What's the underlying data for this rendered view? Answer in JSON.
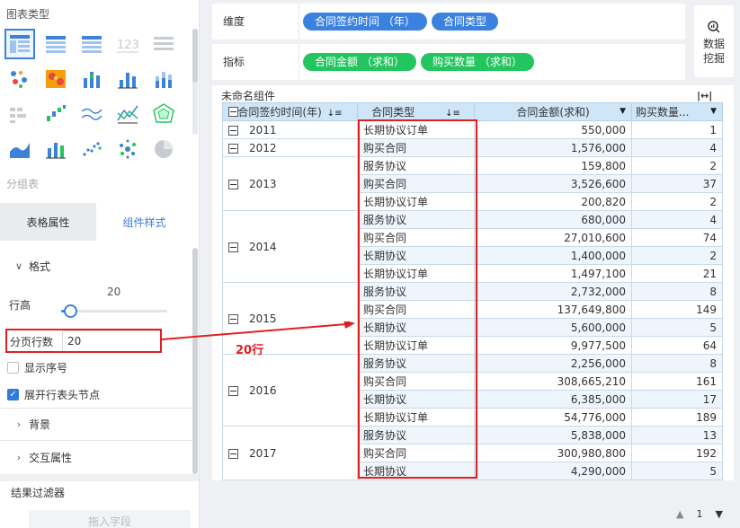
{
  "left": {
    "chart_type_title": "图表类型",
    "chart_icons": [
      "cross-table-icon",
      "grouped-table-icon",
      "detail-table-icon",
      "number-icon",
      "list-table-icon",
      "dot-map-icon",
      "heat-map-icon",
      "grouped-bar-icon",
      "bar-chart-icon",
      "stacked-bar-icon",
      "gantt-icon",
      "waterfall-icon",
      "multi-line-icon",
      "line-point-icon",
      "radar-icon",
      "area-icon",
      "combo-bar-icon",
      "scatter-icon",
      "bubble-icon",
      "pie-icon"
    ],
    "group_table": "分组表",
    "tabs": {
      "table_props": "表格属性",
      "component_style": "组件样式"
    },
    "format": "格式",
    "row_height_label": "行高",
    "row_height_value": "20",
    "row_height_fraction": 0.08,
    "page_rows_label": "分页行数",
    "page_rows_value": "20",
    "show_index_label": "显示序号",
    "expand_header_label": "展开行表头节点",
    "background_label": "背景",
    "interaction_label": "交互属性",
    "result_filter_label": "结果过滤器",
    "drag_field_placeholder": "拖入字段"
  },
  "shelves": {
    "dimension_label": "维度",
    "dimensions": [
      "合同签约时间 （年）",
      "合同类型"
    ],
    "metric_label": "指标",
    "metrics": [
      "合同金额 （求和）",
      "购买数量 （求和）"
    ]
  },
  "mining": {
    "line1": "数据",
    "line2": "挖掘"
  },
  "component_title": "未命名组件",
  "expand_icon_text": "|↔|",
  "table": {
    "headers": [
      "合同签约时间(年)",
      "合同类型",
      "合同金额(求和)",
      "购买数量..."
    ],
    "groups": [
      {
        "year": "2011",
        "rows": [
          [
            "长期协议订单",
            "550,000",
            "1"
          ]
        ]
      },
      {
        "year": "2012",
        "rows": [
          [
            "购买合同",
            "1,576,000",
            "4"
          ]
        ]
      },
      {
        "year": "2013",
        "rows": [
          [
            "服务协议",
            "159,800",
            "2"
          ],
          [
            "购买合同",
            "3,526,600",
            "37"
          ],
          [
            "长期协议订单",
            "200,820",
            "2"
          ]
        ]
      },
      {
        "year": "2014",
        "rows": [
          [
            "服务协议",
            "680,000",
            "4"
          ],
          [
            "购买合同",
            "27,010,600",
            "74"
          ],
          [
            "长期协议",
            "1,400,000",
            "2"
          ],
          [
            "长期协议订单",
            "1,497,100",
            "21"
          ]
        ]
      },
      {
        "year": "2015",
        "rows": [
          [
            "服务协议",
            "2,732,000",
            "8"
          ],
          [
            "购买合同",
            "137,649,800",
            "149"
          ],
          [
            "长期协议",
            "5,600,000",
            "5"
          ],
          [
            "长期协议订单",
            "9,977,500",
            "64"
          ]
        ]
      },
      {
        "year": "2016",
        "rows": [
          [
            "服务协议",
            "2,256,000",
            "8"
          ],
          [
            "购买合同",
            "308,665,210",
            "161"
          ],
          [
            "长期协议",
            "6,385,000",
            "17"
          ],
          [
            "长期协议订单",
            "54,776,000",
            "189"
          ]
        ]
      },
      {
        "year": "2017",
        "rows": [
          [
            "服务协议",
            "5,838,000",
            "13"
          ],
          [
            "购买合同",
            "300,980,800",
            "192"
          ],
          [
            "长期协议",
            "4,290,000",
            "5"
          ]
        ]
      }
    ]
  },
  "annotation": "20行",
  "pager": {
    "up": "▲",
    "page": "1",
    "down": "▼"
  },
  "colors": {
    "accent": "#3b82e0",
    "green_pill": "#22c55e",
    "annotation_red": "#e02020",
    "header_bg": "#cfe6f9"
  }
}
